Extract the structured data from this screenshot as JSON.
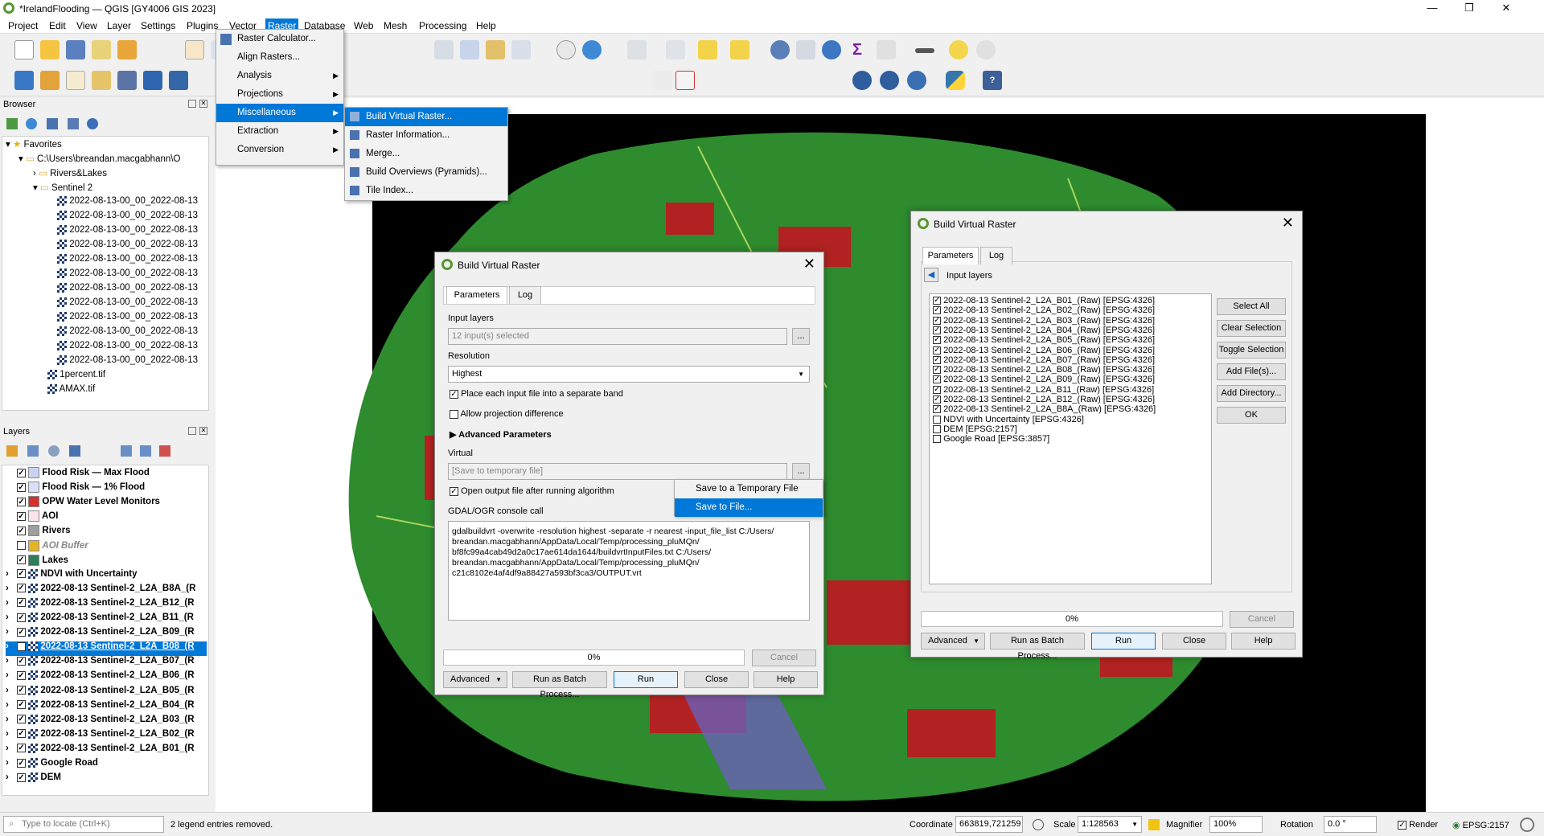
{
  "window": {
    "title": "*IrelandFlooding — QGIS [GY4006 GIS 2023]",
    "minimize": "—",
    "restore": "❐",
    "close": "✕"
  },
  "menubar": [
    "Project",
    "Edit",
    "View",
    "Layer",
    "Settings",
    "Plugins",
    "Vector",
    "Raster",
    "Database",
    "Web",
    "Mesh",
    "Processing",
    "Help"
  ],
  "raster_menu": {
    "items": [
      "Raster Calculator...",
      "Align Rasters...",
      "Analysis",
      "Projections",
      "Miscellaneous",
      "Extraction",
      "Conversion"
    ]
  },
  "misc_menu": {
    "items": [
      "Build Virtual Raster...",
      "Raster Information...",
      "Merge...",
      "Build Overviews (Pyramids)...",
      "Tile Index..."
    ]
  },
  "browser": {
    "title": "Browser",
    "favorites": "Favorites",
    "path": "C:\\Users\\breandan.macgabhann\\O",
    "folders": [
      "Rivers&Lakes",
      "Sentinel 2"
    ],
    "files": [
      "2022-08-13-00_00_2022-08-13",
      "2022-08-13-00_00_2022-08-13",
      "2022-08-13-00_00_2022-08-13",
      "2022-08-13-00_00_2022-08-13",
      "2022-08-13-00_00_2022-08-13",
      "2022-08-13-00_00_2022-08-13",
      "2022-08-13-00_00_2022-08-13",
      "2022-08-13-00_00_2022-08-13",
      "2022-08-13-00_00_2022-08-13",
      "2022-08-13-00_00_2022-08-13",
      "2022-08-13-00_00_2022-08-13",
      "2022-08-13-00_00_2022-08-13"
    ],
    "more": [
      "1percent.tif",
      "AMAX.tif"
    ]
  },
  "layers": {
    "title": "Layers",
    "items": [
      {
        "name": "Flood Risk — Max Flood",
        "checked": "✓",
        "color": "#c9d3f0"
      },
      {
        "name": "Flood Risk — 1% Flood",
        "checked": "✓",
        "color": "#d6e0f8"
      },
      {
        "name": "OPW Water Level Monitors",
        "checked": "✓",
        "color": "#d43030"
      },
      {
        "name": "AOI",
        "checked": "✓",
        "color": "#fce4ec"
      },
      {
        "name": "Rivers",
        "checked": "✓",
        "color": "#9e9e9e"
      },
      {
        "name": "AOI Buffer",
        "checked": "",
        "color": "#e6b422"
      },
      {
        "name": "Lakes",
        "checked": "✓",
        "color": "#2e7d5b"
      },
      {
        "name": "NDVI with Uncertainty",
        "checked": "✓",
        "color": ""
      },
      {
        "name": "2022-08-13 Sentinel-2_L2A_B8A_(R",
        "checked": "✓",
        "color": ""
      },
      {
        "name": "2022-08-13 Sentinel-2_L2A_B12_(R",
        "checked": "✓",
        "color": ""
      },
      {
        "name": "2022-08-13 Sentinel-2_L2A_B11_(R",
        "checked": "✓",
        "color": ""
      },
      {
        "name": "2022-08-13 Sentinel-2_L2A_B09_(R",
        "checked": "✓",
        "color": ""
      },
      {
        "name": "2022-08-13 Sentinel-2_L2A_B08_(R",
        "checked": "✓",
        "color": ""
      },
      {
        "name": "2022-08-13 Sentinel-2_L2A_B07_(R",
        "checked": "✓",
        "color": ""
      },
      {
        "name": "2022-08-13 Sentinel-2_L2A_B06_(R",
        "checked": "✓",
        "color": ""
      },
      {
        "name": "2022-08-13 Sentinel-2_L2A_B05_(R",
        "checked": "✓",
        "color": ""
      },
      {
        "name": "2022-08-13 Sentinel-2_L2A_B04_(R",
        "checked": "✓",
        "color": ""
      },
      {
        "name": "2022-08-13 Sentinel-2_L2A_B03_(R",
        "checked": "✓",
        "color": ""
      },
      {
        "name": "2022-08-13 Sentinel-2_L2A_B02_(R",
        "checked": "✓",
        "color": ""
      },
      {
        "name": "2022-08-13 Sentinel-2_L2A_B01_(R",
        "checked": "✓",
        "color": ""
      },
      {
        "name": "Google Road",
        "checked": "✓",
        "color": ""
      },
      {
        "name": "DEM",
        "checked": "✓",
        "color": ""
      }
    ]
  },
  "dialog1": {
    "title": "Build Virtual Raster",
    "tab_params": "Parameters",
    "tab_log": "Log",
    "input_layers_label": "Input layers",
    "input_layers_value": "12 input(s) selected",
    "browse": "...",
    "resolution_label": "Resolution",
    "resolution_value": "Highest",
    "chk_separate": "Place each input file into a separate band",
    "chk_proj": "Allow projection difference",
    "advanced": "Advanced Parameters",
    "virtual_label": "Virtual",
    "virtual_placeholder": "[Save to temporary file]",
    "chk_open": "Open output file after running algorithm",
    "console_label": "GDAL/OGR console call",
    "console": "gdalbuildvrt -overwrite -resolution highest -separate -r nearest -input_file_list C:/Users/\nbreandan.macgabhann/AppData/Local/Temp/processing_pluMQn/\nbf8fc99a4cab49d2a0c17ae614da1644/buildvrtInputFiles.txt C:/Users/\nbreandan.macgabhann/AppData/Local/Temp/processing_pluMQn/\nc21c8102e4af4df9a88427a593bf3ca3/OUTPUT.vrt",
    "progress": "0%",
    "cancel": "Cancel",
    "advanced_btn": "Advanced",
    "batch": "Run as Batch Process...",
    "run": "Run",
    "close": "Close",
    "help": "Help"
  },
  "save_popup": [
    "Save to a Temporary File",
    "Save to File..."
  ],
  "dialog2": {
    "title": "Build Virtual Raster",
    "tab_params": "Parameters",
    "tab_log": "Log",
    "header": "Input layers",
    "items": [
      {
        "label": "2022-08-13 Sentinel-2_L2A_B01_(Raw) [EPSG:4326]",
        "checked": "✓"
      },
      {
        "label": "2022-08-13 Sentinel-2_L2A_B02_(Raw) [EPSG:4326]",
        "checked": "✓"
      },
      {
        "label": "2022-08-13 Sentinel-2_L2A_B03_(Raw) [EPSG:4326]",
        "checked": "✓"
      },
      {
        "label": "2022-08-13 Sentinel-2_L2A_B04_(Raw) [EPSG:4326]",
        "checked": "✓"
      },
      {
        "label": "2022-08-13 Sentinel-2_L2A_B05_(Raw) [EPSG:4326]",
        "checked": "✓"
      },
      {
        "label": "2022-08-13 Sentinel-2_L2A_B06_(Raw) [EPSG:4326]",
        "checked": "✓"
      },
      {
        "label": "2022-08-13 Sentinel-2_L2A_B07_(Raw) [EPSG:4326]",
        "checked": "✓"
      },
      {
        "label": "2022-08-13 Sentinel-2_L2A_B08_(Raw) [EPSG:4326]",
        "checked": "✓"
      },
      {
        "label": "2022-08-13 Sentinel-2_L2A_B09_(Raw) [EPSG:4326]",
        "checked": "✓"
      },
      {
        "label": "2022-08-13 Sentinel-2_L2A_B11_(Raw) [EPSG:4326]",
        "checked": "✓"
      },
      {
        "label": "2022-08-13 Sentinel-2_L2A_B12_(Raw) [EPSG:4326]",
        "checked": "✓"
      },
      {
        "label": "2022-08-13 Sentinel-2_L2A_B8A_(Raw) [EPSG:4326]",
        "checked": "✓"
      },
      {
        "label": "NDVI with Uncertainty [EPSG:4326]",
        "checked": ""
      },
      {
        "label": "DEM [EPSG:2157]",
        "checked": ""
      },
      {
        "label": "Google Road [EPSG:3857]",
        "checked": ""
      }
    ],
    "select_all": "Select All",
    "clear": "Clear Selection",
    "toggle": "Toggle Selection",
    "add_files": "Add File(s)...",
    "add_dir": "Add Directory...",
    "ok": "OK",
    "progress": "0%",
    "cancel": "Cancel",
    "advanced_btn": "Advanced",
    "batch": "Run as Batch Process...",
    "run": "Run",
    "close": "Close",
    "help": "Help"
  },
  "statusbar": {
    "locate_placeholder": "Type to locate (Ctrl+K)",
    "message": "2 legend entries removed.",
    "coord_label": "Coordinate",
    "coord": "663819,721259",
    "scale_label": "Scale",
    "scale": "1:128563",
    "magnifier_label": "Magnifier",
    "magnifier": "100%",
    "rotation_label": "Rotation",
    "rotation": "0.0 °",
    "render": "Render",
    "crs": "EPSG:2157"
  }
}
